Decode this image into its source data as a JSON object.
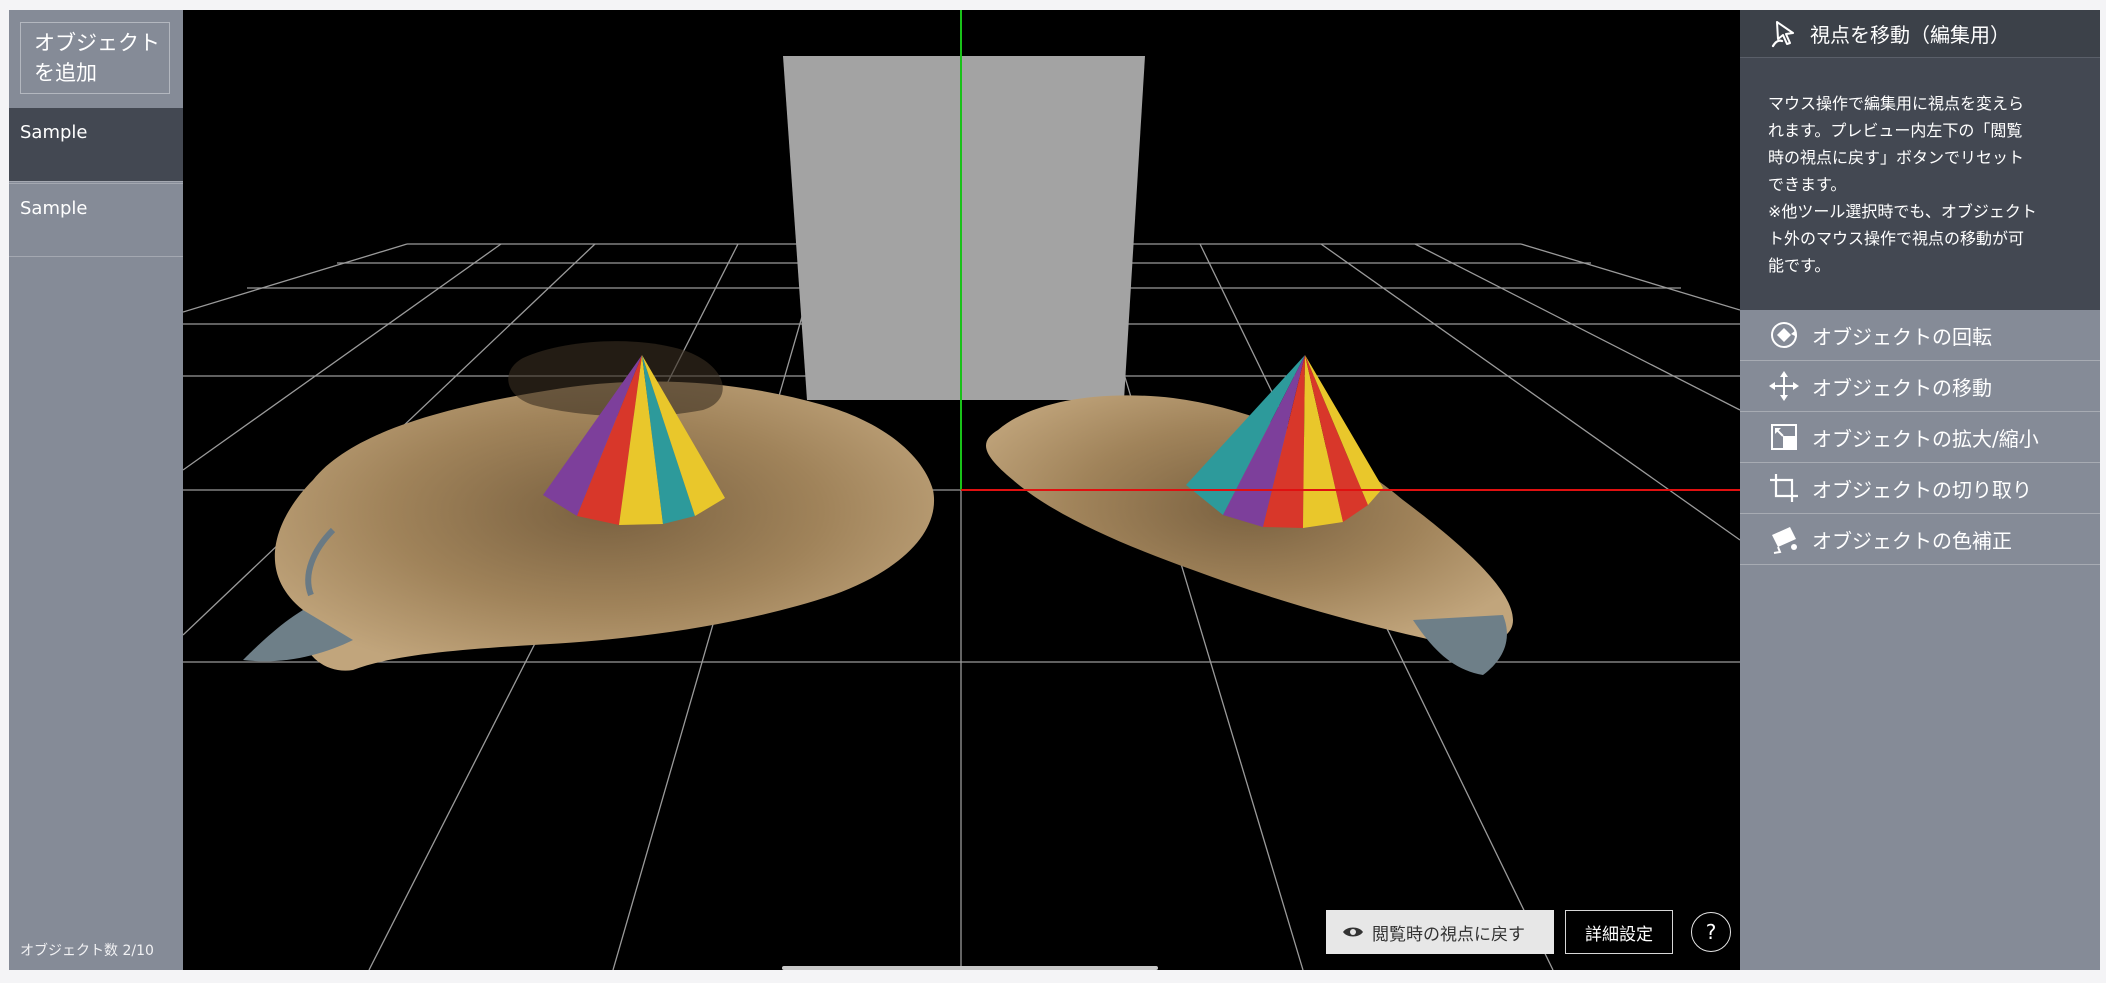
{
  "left_panel": {
    "add_button": "オブジェクト\nを追加",
    "objects": [
      {
        "label": "Sample",
        "selected": true
      },
      {
        "label": "Sample",
        "selected": false
      }
    ],
    "object_count": "オブジェクト数 2/10"
  },
  "viewport": {
    "reset_view_button": "閲覧時の視点に戻す",
    "advanced_settings_button": "詳細設定",
    "help_button": "?"
  },
  "tools": {
    "active": {
      "label": "視点を移動（編集用）",
      "icon": "cursor-move-icon",
      "description": "マウス操作で編集用に視点を変えら\nれます。プレビュー内左下の「閲覧\n時の視点に戻す」ボタンでリセット\nできます。\n※他ツール選択時でも、オブジェクト\nト外のマウス操作で視点の移動が可\n能です。"
    },
    "items": [
      {
        "label": "オブジェクトの回転",
        "icon": "rotate-icon"
      },
      {
        "label": "オブジェクトの移動",
        "icon": "move-arrows-icon"
      },
      {
        "label": "オブジェクトの拡大/縮小",
        "icon": "scale-icon"
      },
      {
        "label": "オブジェクトの切り取り",
        "icon": "crop-icon"
      },
      {
        "label": "オブジェクトの色補正",
        "icon": "paint-icon"
      }
    ]
  },
  "colors": {
    "sidebar": "#858b97",
    "selected": "#434852",
    "viewport_bg": "#000000",
    "axis_y": "#19c219",
    "axis_x": "#e01010",
    "grid": "#9a9a9a",
    "box": "#a3a3a3"
  }
}
